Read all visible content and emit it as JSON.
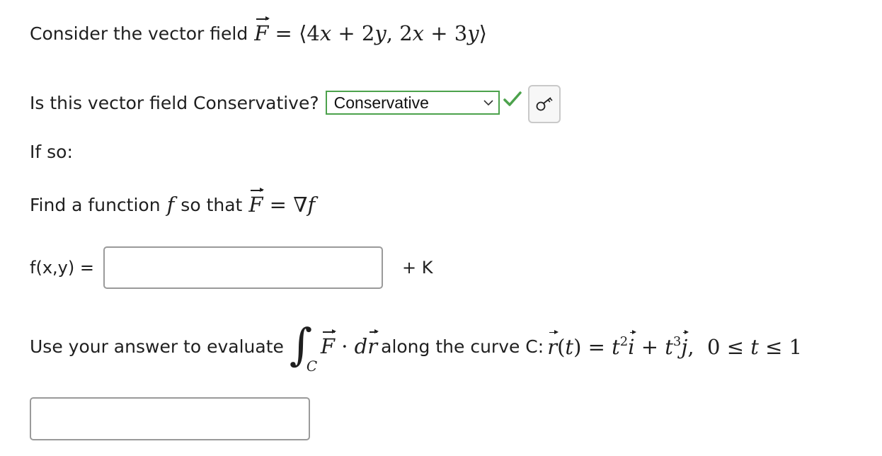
{
  "consider": {
    "prefix": "Consider the vector field"
  },
  "conservative_question": {
    "label": "Is this vector field Conservative?",
    "selected_value": "Conservative"
  },
  "if_so": {
    "label": "If so:"
  },
  "find_function": {
    "prefix": "Find a function",
    "f": "f",
    "middle": "so that"
  },
  "fxy": {
    "label": "f(x,y) =",
    "value": "",
    "suffix": "+ K"
  },
  "evaluate": {
    "prefix": "Use your answer to evaluate",
    "curve_label": "along the curve C:",
    "integral_subscript": "C"
  },
  "answer": {
    "value": ""
  },
  "colors": {
    "correct": "#4ca24c",
    "text": "#1f1f1f",
    "input_border": "#9a9a9a"
  },
  "icons": {
    "dropdown": "chevron-down-icon",
    "correct": "check-icon",
    "key": "key-icon"
  }
}
